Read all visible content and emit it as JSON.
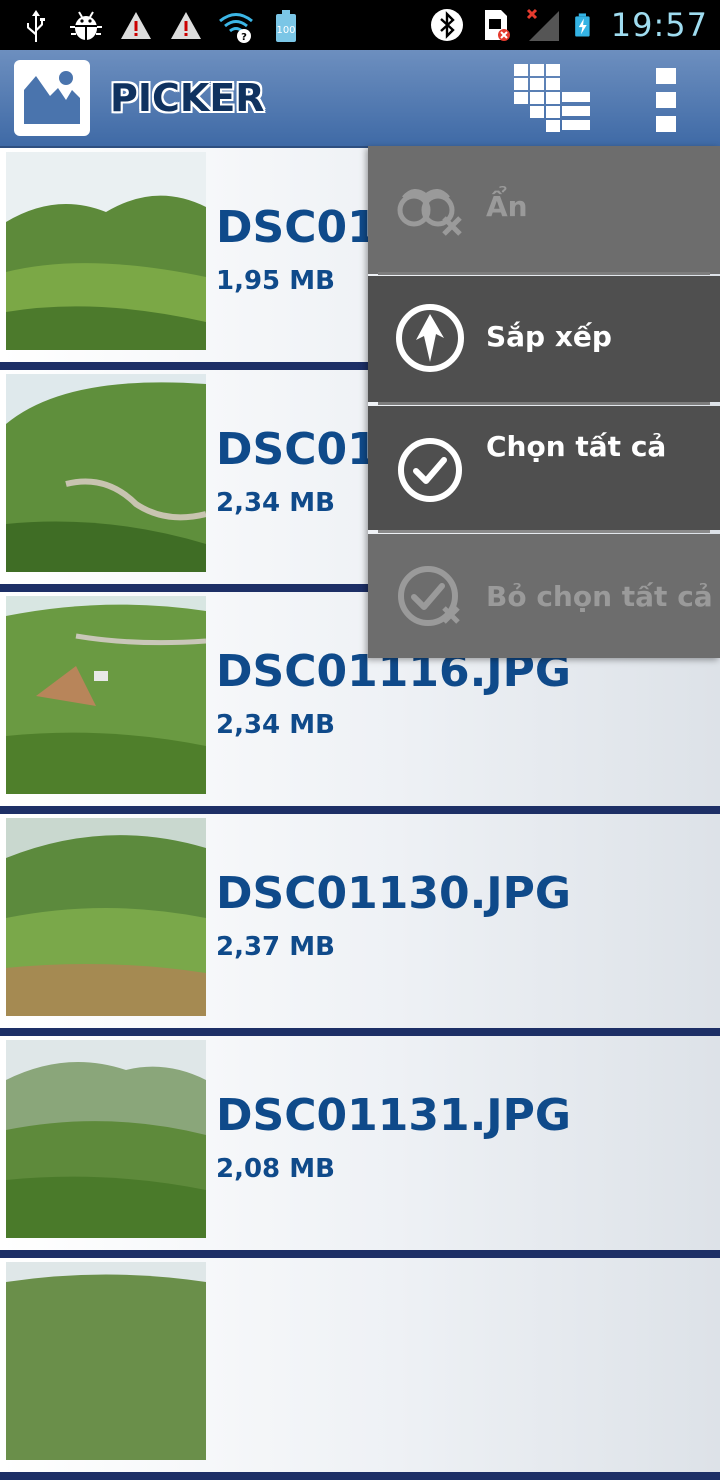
{
  "status_bar": {
    "time": "19:57",
    "battery_level": "100",
    "left_icons": [
      "usb-icon",
      "android-debug-icon",
      "warning-icon",
      "warning-icon",
      "wifi-icon",
      "battery-100-icon"
    ],
    "right_icons": [
      "bluetooth-icon",
      "sim-card-icon",
      "no-signal-icon",
      "battery-charging-icon"
    ]
  },
  "action_bar": {
    "title": "PICKER",
    "icons": [
      "app-logo-icon",
      "grid-view-icon",
      "overflow-menu-icon"
    ]
  },
  "files": [
    {
      "name": "DSC01",
      "size": "1,95 MB"
    },
    {
      "name": "DSC01",
      "size": "2,34 MB"
    },
    {
      "name": "DSC01116.JPG",
      "size": "2,34 MB"
    },
    {
      "name": "DSC01130.JPG",
      "size": "2,37 MB"
    },
    {
      "name": "DSC01131.JPG",
      "size": "2,08 MB"
    }
  ],
  "menu": {
    "items": [
      {
        "label": "Ẩn",
        "icon": "hide-binoculars-icon",
        "enabled": false
      },
      {
        "label": "Sắp xếp",
        "icon": "sort-icon",
        "enabled": true
      },
      {
        "label": "Chọn tất cả",
        "icon": "select-all-icon",
        "enabled": true
      },
      {
        "label": "Bỏ chọn tất cả",
        "icon": "deselect-all-icon",
        "enabled": false
      }
    ]
  },
  "colors": {
    "action_bar": "#4a74ad",
    "file_text": "#0f4a8a",
    "row_separator": "#1d2f66",
    "menu_enabled": "#4f4f4f",
    "menu_disabled": "#6d6d6d"
  }
}
